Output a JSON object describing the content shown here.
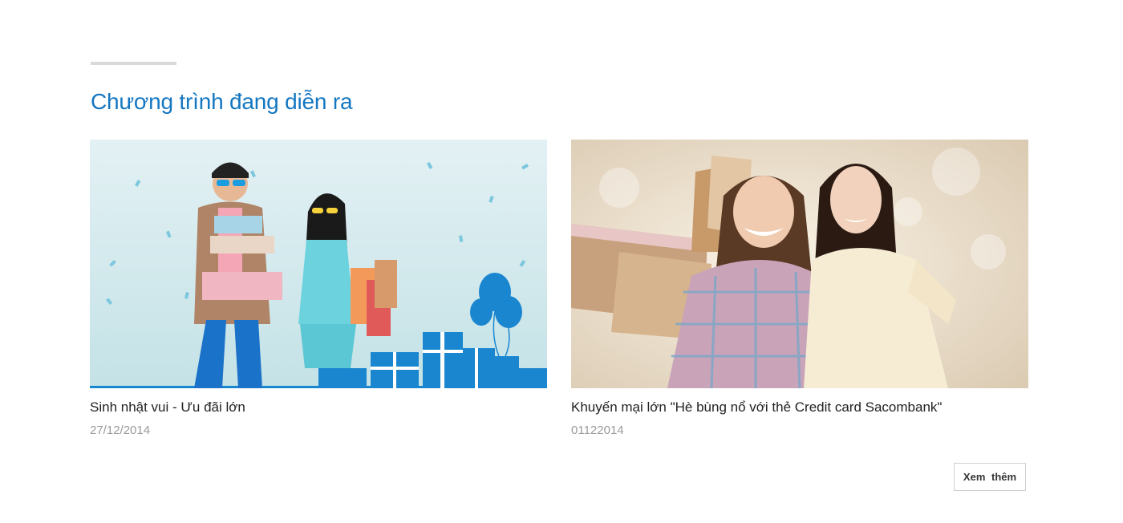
{
  "section": {
    "title": "Chương trình đang diễn ra"
  },
  "promotions": [
    {
      "title": "Sinh nhật vui - Ưu đãi lớn",
      "date": "27/12/2014",
      "image": "birthday-promo-image"
    },
    {
      "title": "Khuyến mại lớn \"Hè bùng nổ với thẻ Credit card Sacombank\"",
      "date": "01122014",
      "image": "shopping-promo-image"
    }
  ],
  "more_button": {
    "label": "Xem thêm"
  },
  "colors": {
    "accent": "#1477c1",
    "divider": "#d9d9d9",
    "muted": "#9a9a9a",
    "promo_blue": "#1a86d0"
  }
}
